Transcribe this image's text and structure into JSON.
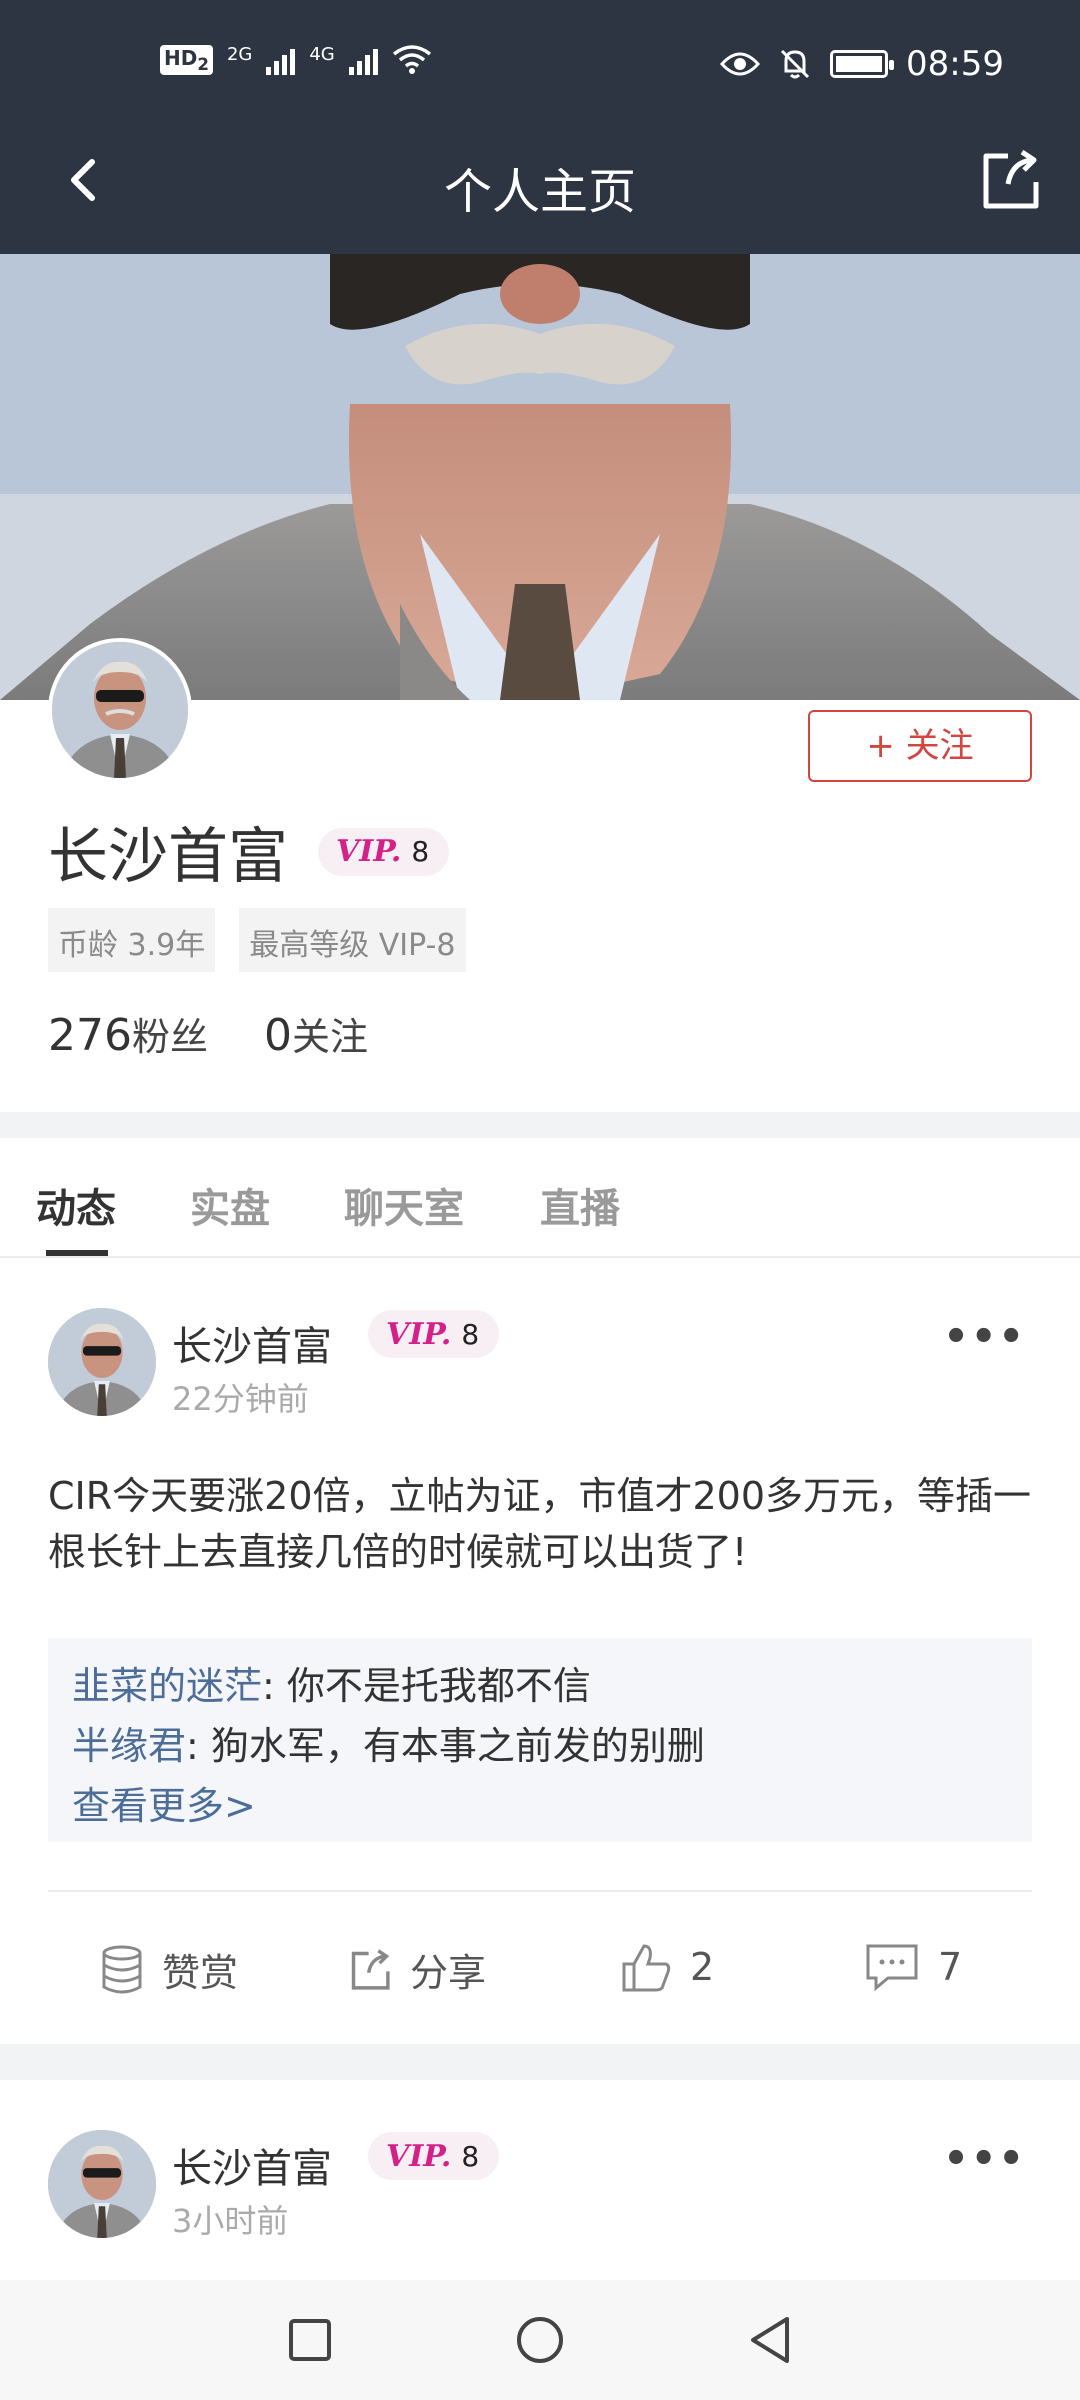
{
  "status_bar": {
    "hd_label": "HD",
    "hd_sub": "2",
    "net1": "2G",
    "net2": "4G",
    "time": "08:59"
  },
  "header": {
    "title": "个人主页"
  },
  "profile": {
    "name": "长沙首富",
    "vip_logo": "VIP.",
    "vip_level": "8",
    "follow_label": "+ 关注",
    "tags": [
      "币龄 3.9年",
      "最高等级 VIP-8"
    ],
    "fans_count": "276",
    "fans_label": "粉丝",
    "following_count": "0",
    "following_label": "关注"
  },
  "tabs": [
    "动态",
    "实盘",
    "聊天室",
    "直播"
  ],
  "active_tab": 0,
  "posts": [
    {
      "author": "长沙首富",
      "vip_level": "8",
      "time": "22分钟前",
      "content": "CIR今天要涨20倍，立帖为证，市值才200多万元，等插一根长针上去直接几倍的时候就可以出货了!",
      "comments": [
        {
          "user": "韭菜的迷茫",
          "text": ": 你不是托我都不信"
        },
        {
          "user": "半缘君",
          "text": ": 狗水军，有本事之前发的别删"
        }
      ],
      "see_more": "查看更多>",
      "actions": {
        "reward": "赞赏",
        "share": "分享",
        "likes": "2",
        "comments": "7"
      }
    },
    {
      "author": "长沙首富",
      "vip_level": "8",
      "time": "3小时前"
    }
  ],
  "colors": {
    "header_bg": "#2d3542",
    "accent_red": "#d2463f",
    "vip_pink": "#d4218a",
    "link_blue": "#4c6d99"
  }
}
